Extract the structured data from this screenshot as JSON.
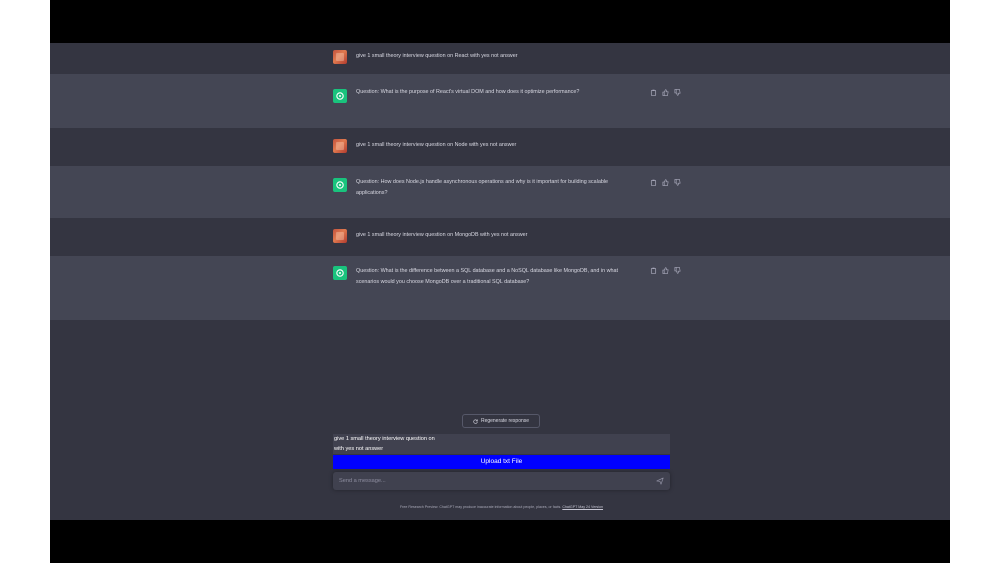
{
  "conversation": [
    {
      "role": "user",
      "text": "give 1 small theory interview question on React with yes not answer"
    },
    {
      "role": "assistant",
      "text": "Question: What is the purpose of React's virtual DOM and how does it optimize performance?"
    },
    {
      "role": "user",
      "text": "give 1 small theory interview question on Node with yes not answer"
    },
    {
      "role": "assistant",
      "text": "Question: How does Node.js handle asynchronous operations and why is it important for building scalable applications?"
    },
    {
      "role": "user",
      "text": "give 1 small theory interview question on MongoDB with yes not answer"
    },
    {
      "role": "assistant",
      "text": "Question: What is the difference between a SQL database and a NoSQL database like MongoDB, and in what scenarios would you choose MongoDB over a traditional SQL database?"
    }
  ],
  "regenerate_label": "Regenerate response",
  "composer": {
    "draft_lines": [
      "give 1 small theory interview question on",
      "with yes not answer"
    ],
    "upload_label": "Upload txt File",
    "placeholder": "Send a message..."
  },
  "footer": {
    "text": "Free Research Preview. ChatGPT may produce inaccurate information about people, places, or facts.",
    "link": "ChatGPT May 24 Version"
  },
  "colors": {
    "app_bg": "#343541",
    "assistant_row_bg": "#444654",
    "assistant_avatar": "#19c37d",
    "upload_button": "#0000ff",
    "letterbox": "#000000"
  },
  "icons": {
    "assistant_avatar": "openai-logo-icon",
    "copy": "clipboard-icon",
    "like": "thumbs-up-icon",
    "dislike": "thumbs-down-icon",
    "regenerate": "refresh-icon",
    "send": "paper-plane-icon"
  }
}
